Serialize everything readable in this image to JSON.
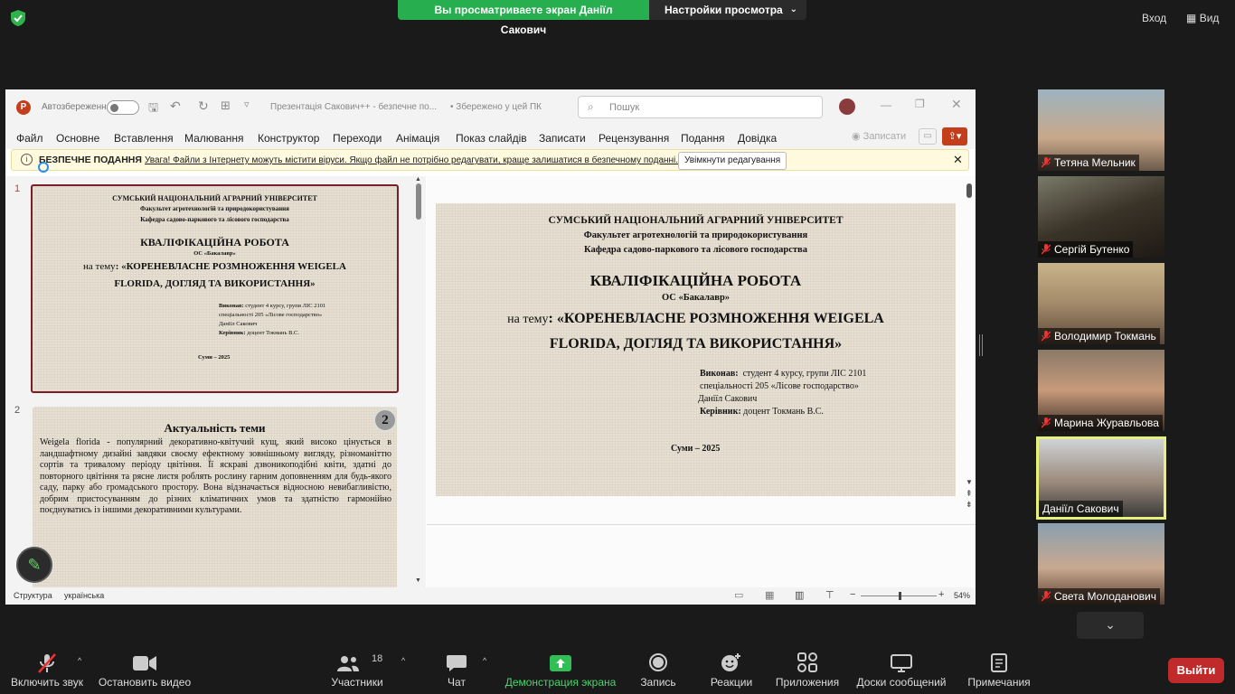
{
  "zoom_top": {
    "sharing_banner": "Вы просматриваете экран Даніїл Сакович",
    "view_options": "Настройки просмотра",
    "exit_fullscreen": "Вход",
    "view_label": "Вид"
  },
  "ppt": {
    "autosave": "Автозбереження",
    "doc_title": "Презентація Сакович++  -  безпечне по...",
    "save_status": "• Збережено у цей ПК",
    "search_placeholder": "Пошук",
    "menu": [
      "Файл",
      "Основне",
      "Вставлення",
      "Малювання",
      "Конструктор",
      "Переходи",
      "Анімація",
      "Показ слайдів",
      "Записати",
      "Рецензування",
      "Подання",
      "Довідка"
    ],
    "record_btn": "Записати",
    "warn_title": "БЕЗПЕЧНЕ ПОДАННЯ",
    "warn_text": "Увага! Файли з Інтернету можуть містити віруси. Якщо файл не потрібно редагувати, краще залишатися в безпечному поданні.",
    "enable_edit": "Увімкнути редагування",
    "slide_numbers": [
      "1",
      "2"
    ],
    "status_outline": "Структура",
    "status_lang": "українська",
    "zoom": "54%"
  },
  "slide1": {
    "univ": "СУМСЬКИЙ НАЦІОНАЛЬНИЙ АГРАРНИЙ УНІВЕРСИТЕТ",
    "faculty": "Факультет агротехнологій та природокористування",
    "dept": "Кафедра садово-паркового та лісового господарства",
    "work": "КВАЛІФІКАЦІЙНА РОБОТА",
    "degree": "ОС «Бакалавр»",
    "theme_prefix": "на тему",
    "theme_colon": ":",
    "theme_line1": "«КОРЕНЕВЛАСНЕ РОЗМНОЖЕННЯ WEIGELA",
    "theme_line2": "FLORIDA, ДОГЛЯД ТА ВИКОРИСТАННЯ»",
    "done_label": "Виконав:",
    "done_text": "студент 4 курсу, групи ЛІС 2101",
    "spec_text": "спеціальності  205   «Лісове господарство»",
    "author": "Даніїл Сакович",
    "sup_label": "Керівник:",
    "sup_text": "доцент Токмань В.С.",
    "city": "Суми – 2025"
  },
  "slide2": {
    "badge": "2",
    "title": "Актуальність теми",
    "body": "Weigela florida - популярний декоративно-квітучий кущ, який високо цінується в ландшафтному дизайні завдяки своєму ефектному зовнішньому вигляду, різноманіттю сортів та тривалому періоду цвітіння. Її яскраві дзвоникоподібні квіти, здатні до повторного цвітіння та рясне листя роблять рослину гарним доповненням для будь-якого саду, парку або громадського простору. Вона відзначається відносною невибагливістю, добрим пристосуванням до різних кліматичних умов та здатністю гармонійно поєднуватись із іншими декоративними культурами."
  },
  "participants": [
    {
      "name": "Тетяна Мельник",
      "muted": true
    },
    {
      "name": "Сергій Бутенко",
      "muted": true
    },
    {
      "name": "Володимир Токмань",
      "muted": true
    },
    {
      "name": "Марина Журавльова",
      "muted": true
    },
    {
      "name": "Даніїл Сакович",
      "muted": false
    },
    {
      "name": "Света Молоданович",
      "muted": true
    }
  ],
  "toolbar": {
    "unmute": "Включить звук",
    "stop_video": "Остановить видео",
    "participants": "Участники",
    "participants_count": "18",
    "chat": "Чат",
    "share": "Демонстрация экрана",
    "record": "Запись",
    "reactions": "Реакции",
    "apps": "Приложения",
    "whiteboards": "Доски сообщений",
    "notes": "Примечания",
    "leave": "Выйти"
  },
  "colors": {
    "share_green": "#27ae4f",
    "leave_red": "#c12a2a",
    "active_speaker": "#e7f07a",
    "ppt_accent": "#c43e1c",
    "slide_border": "#7a1f28"
  }
}
